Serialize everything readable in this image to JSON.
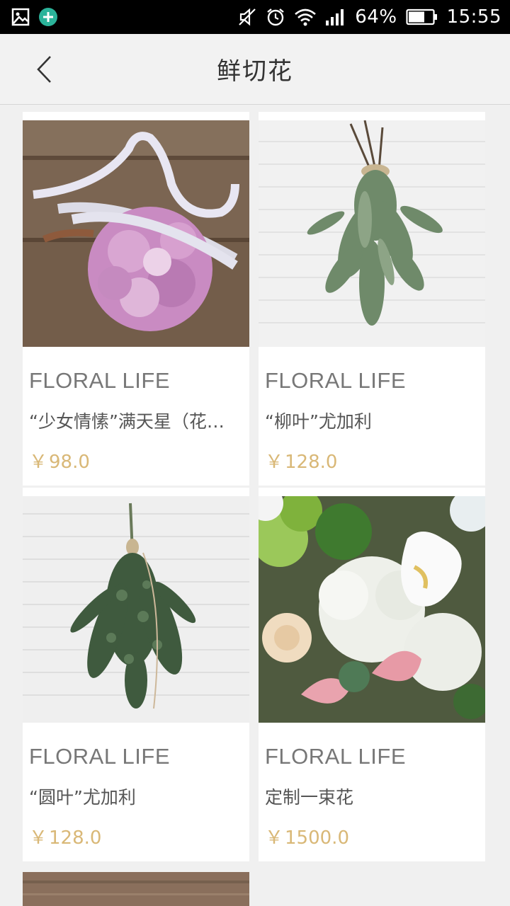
{
  "status_bar": {
    "battery_percent": "64%",
    "time": "15:55",
    "icons": [
      "gallery-icon",
      "plus-circle-icon",
      "mute-icon",
      "alarm-icon",
      "wifi-icon",
      "signal-icon",
      "battery-icon"
    ]
  },
  "header": {
    "title": "鲜切花",
    "back_icon": "chevron-left-icon"
  },
  "products": [
    {
      "brand": "FLORAL LIFE",
      "name": "“少女情愫”满天星（花…",
      "currency": "￥",
      "price": "98.0",
      "image": "pink-gypsophila-ball"
    },
    {
      "brand": "FLORAL LIFE",
      "name": "“柳叶”尤加利",
      "currency": "￥",
      "price": "128.0",
      "image": "willow-eucalyptus-bunch"
    },
    {
      "brand": "FLORAL LIFE",
      "name": "“圆叶”尤加利",
      "currency": "￥",
      "price": "128.0",
      "image": "round-eucalyptus-bunch"
    },
    {
      "brand": "FLORAL LIFE",
      "name": "定制一束花",
      "currency": "￥",
      "price": "1500.0",
      "image": "calla-hydrangea-bouquet"
    },
    {
      "brand": "",
      "name": "",
      "currency": "",
      "price": "",
      "image": "wooden-table-partial"
    }
  ],
  "colors": {
    "status_bar_bg": "#000000",
    "header_bg": "#f2f2f2",
    "page_bg": "#f0f0f0",
    "price": "#d9b877",
    "brand_text": "#777777"
  }
}
